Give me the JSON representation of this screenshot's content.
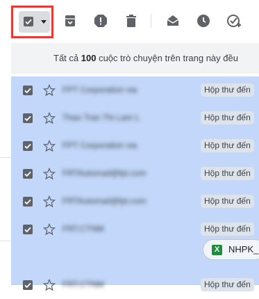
{
  "toolbar": {
    "select_all_checked": true,
    "icons": [
      "checkbox-checked-icon",
      "dropdown-caret-icon",
      "archive-icon",
      "report-spam-icon",
      "delete-icon",
      "mark-as-read-icon",
      "snooze-icon",
      "add-to-tasks-icon"
    ]
  },
  "banner": {
    "prefix": "Tất cả ",
    "count": "100",
    "suffix": " cuộc trò chuyện trên trang này đều"
  },
  "rows": [
    {
      "sender": "FPT Corporation via",
      "label": "Hộp thư đến"
    },
    {
      "sender": "Thao Tran Thi Lam L",
      "label": "Hộp thư đến"
    },
    {
      "sender": "FPT Corporation via",
      "label": "Hộp thư đến"
    },
    {
      "sender": "FRTAutomail@fpt.com",
      "label": "Hộp thư đến"
    },
    {
      "sender": "FRTAutomail@fpt.com",
      "label": "Hộp thư đến"
    },
    {
      "sender": "FRT.CTNM",
      "label": "Hộp thư đến",
      "attachment": "NHPK_"
    },
    {
      "sender": "FRT.CTNM",
      "label": "Hộp thư đến"
    }
  ],
  "colors": {
    "selected_row_bg": "#c2d7f9",
    "highlight_border": "#e53935",
    "label_bg": "#dde3ea",
    "excel_green": "#1e8e3e"
  }
}
